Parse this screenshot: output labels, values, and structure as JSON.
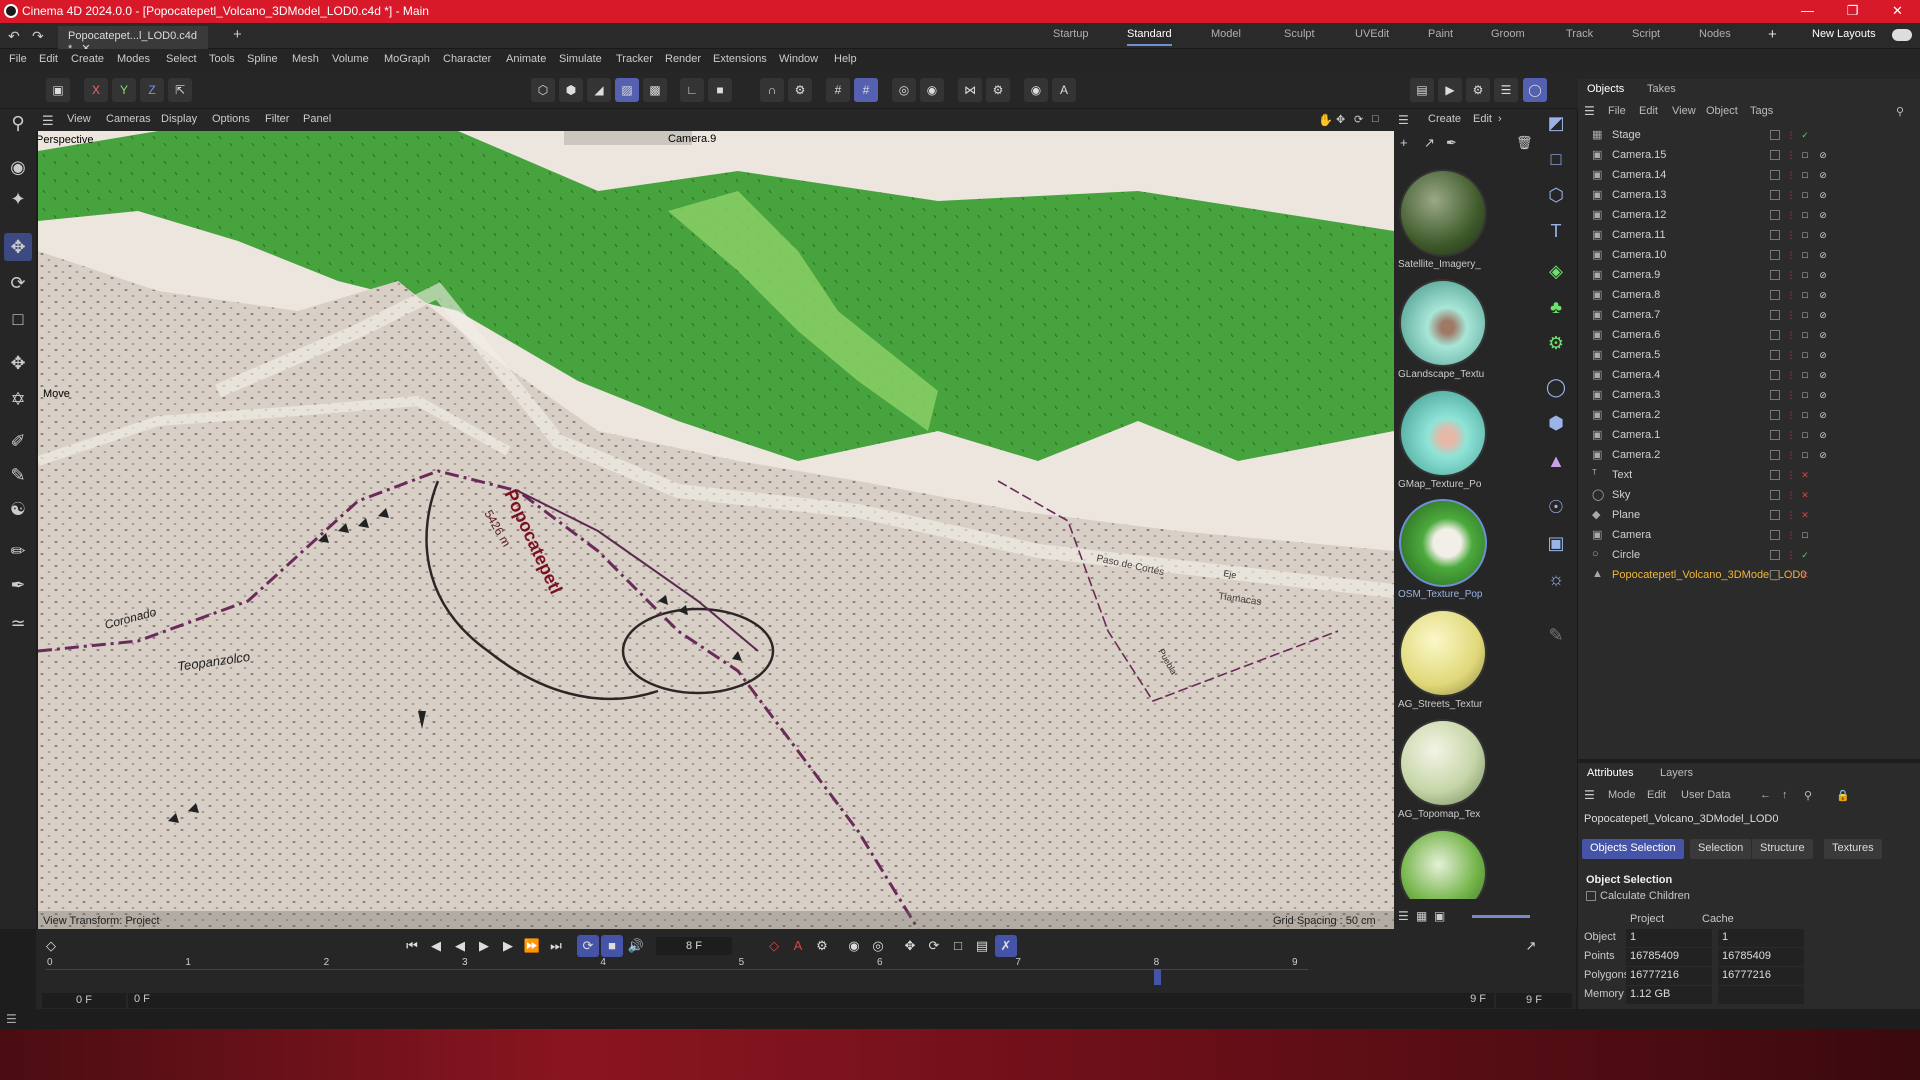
{
  "window": {
    "title": "Cinema 4D 2024.0.0 - [Popocatepetl_Volcano_3DModel_LOD0.c4d *] - Main"
  },
  "tabs": {
    "doc": "Popocatepet...l_LOD0.c4d *",
    "layouts": [
      "Startup",
      "Standard",
      "Model",
      "Sculpt",
      "UVEdit",
      "Paint",
      "Groom",
      "Track",
      "Script",
      "Nodes"
    ],
    "active": "Standard",
    "new_layouts": "New Layouts"
  },
  "menu": [
    "File",
    "Edit",
    "Create",
    "Modes",
    "Select",
    "Tools",
    "Spline",
    "Mesh",
    "Volume",
    "MoGraph",
    "Character",
    "Animate",
    "Simulate",
    "Tracker",
    "Render",
    "Extensions",
    "Window",
    "Help"
  ],
  "axis": {
    "x": "X",
    "y": "Y",
    "z": "Z"
  },
  "viewport": {
    "menu": [
      "View",
      "Cameras",
      "Display",
      "Options",
      "Filter",
      "Panel"
    ],
    "projection": "Perspective",
    "camera": "Camera.9",
    "tool": "Move",
    "transform": "View Transform: Project",
    "grid": "Grid Spacing : 50 cm",
    "map_labels": [
      "Popocatepetl",
      "5426 m",
      "Paso de Cortés",
      "Tlamacas",
      "Teopanzolco",
      "Coronado",
      "Puebla",
      "Eje"
    ]
  },
  "materials": {
    "menu": [
      "Create",
      "Edit"
    ],
    "items": [
      {
        "name": "Satellite_Imagery_",
        "color": "#3e5a2a"
      },
      {
        "name": "GLandscape_Textu",
        "color": "#7fcfb9"
      },
      {
        "name": "GMap_Texture_Po",
        "color": "#6fd0c4"
      },
      {
        "name": "OSM_Texture_Pop",
        "color": "#4caa3c"
      },
      {
        "name": "AG_Streets_Textur",
        "color": "#e6e08a"
      },
      {
        "name": "AG_Topomap_Tex",
        "color": "#c6d6a8"
      },
      {
        "name": "",
        "color": "#76b64c"
      }
    ]
  },
  "objects": {
    "tabs": [
      "Objects",
      "Takes"
    ],
    "menu": [
      "File",
      "Edit",
      "View",
      "Object",
      "Tags"
    ],
    "rows": [
      "Stage",
      "Camera.15",
      "Camera.14",
      "Camera.13",
      "Camera.12",
      "Camera.11",
      "Camera.10",
      "Camera.9",
      "Camera.8",
      "Camera.7",
      "Camera.6",
      "Camera.5",
      "Camera.4",
      "Camera.3",
      "Camera.2",
      "Camera.1",
      "Camera.2",
      "Text",
      "Sky",
      "Plane",
      "Camera",
      "Circle",
      "Popocatepetl_Volcano_3DModel_LOD0"
    ]
  },
  "attributes": {
    "tabs": [
      "Attributes",
      "Layers"
    ],
    "menu": [
      "Mode",
      "Edit",
      "User Data"
    ],
    "object_name": "Popocatepetl_Volcano_3DModel_LOD0",
    "subtabs": [
      "Objects Selection",
      "Selection",
      "Structure",
      "Textures"
    ],
    "section": "Object Selection",
    "calc_children": "Calculate Children",
    "col_project": "Project",
    "col_cache": "Cache",
    "rows": [
      {
        "label": "Object",
        "project": "1",
        "cache": "1"
      },
      {
        "label": "Points",
        "project": "16785409",
        "cache": "16785409"
      },
      {
        "label": "Polygons",
        "project": "16777216",
        "cache": "16777216"
      },
      {
        "label": "Memory",
        "project": "1.12 GB",
        "cache": ""
      }
    ]
  },
  "timeline": {
    "current_frame": "8 F",
    "start": "0 F",
    "start2": "0 F",
    "end": "9 F",
    "end2": "9 F",
    "ticks": [
      "0",
      "1",
      "2",
      "3",
      "4",
      "5",
      "6",
      "7",
      "8",
      "9"
    ]
  }
}
